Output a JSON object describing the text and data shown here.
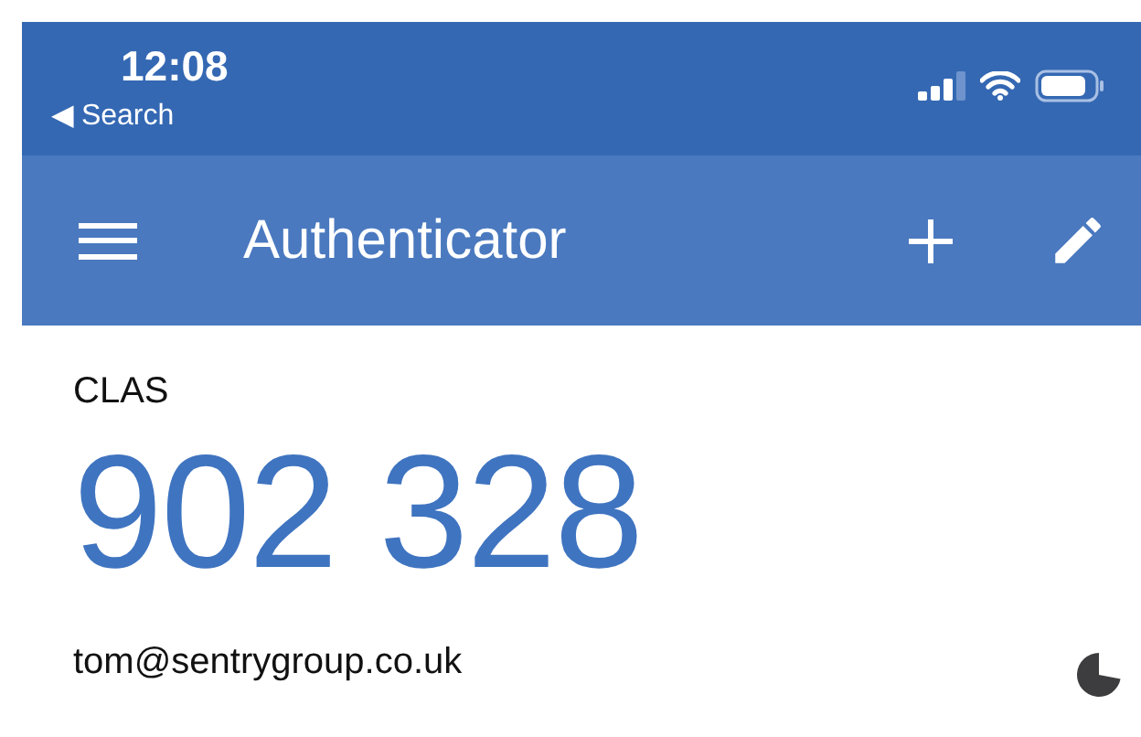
{
  "status_bar": {
    "time": "12:08",
    "back_link": "◀ Search"
  },
  "header": {
    "title": "Authenticator"
  },
  "accounts": [
    {
      "issuer": "CLAS",
      "code": "902 328",
      "account": "tom@sentrygroup.co.uk"
    }
  ]
}
